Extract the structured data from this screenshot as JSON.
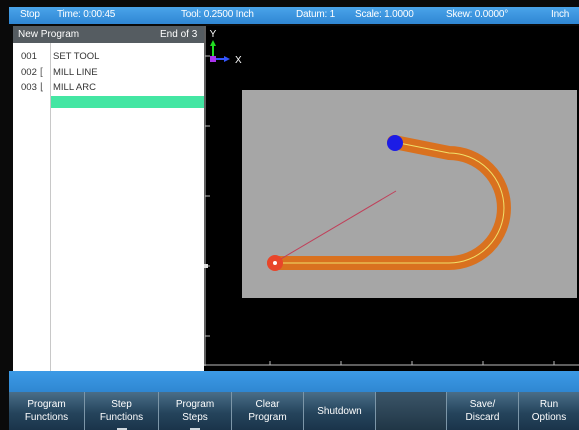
{
  "status_bar": {
    "mode": "Stop",
    "time": "Time: 0:00:45",
    "tool": "Tool: 0.2500 Inch",
    "datum": "Datum: 1",
    "scale": "Scale: 1.0000",
    "skew": "Skew: 0.0000°",
    "units": "Inch"
  },
  "program": {
    "title": "New Program",
    "position": "End of 3",
    "steps": [
      {
        "number": "001",
        "name": "SET TOOL",
        "bracket": ""
      },
      {
        "number": "002",
        "name": "MILL LINE",
        "bracket": "["
      },
      {
        "number": "003",
        "name": "MILL ARC",
        "bracket": "⌊"
      }
    ]
  },
  "viewport": {
    "axis_y_label": "Y",
    "axis_x_label": "X",
    "colors": {
      "background": "#000000",
      "work_area": "#a6a6a6",
      "toolpath": "#d9711f",
      "centerline": "#f0e06a",
      "start_marker": "#1c1ce6",
      "end_marker": "#e8452a",
      "guide_line": "#c0405a"
    }
  },
  "softkeys": [
    {
      "line1": "Program",
      "line2": "Functions"
    },
    {
      "line1": "Step",
      "line2": "Functions"
    },
    {
      "line1": "Program",
      "line2": "Steps"
    },
    {
      "line1": "Clear",
      "line2": "Program"
    },
    {
      "line1": "Shutdown",
      "line2": ""
    },
    {
      "line1": "",
      "line2": ""
    },
    {
      "line1": "Save/",
      "line2": "Discard"
    },
    {
      "line1": "Run",
      "line2": "Options"
    }
  ]
}
